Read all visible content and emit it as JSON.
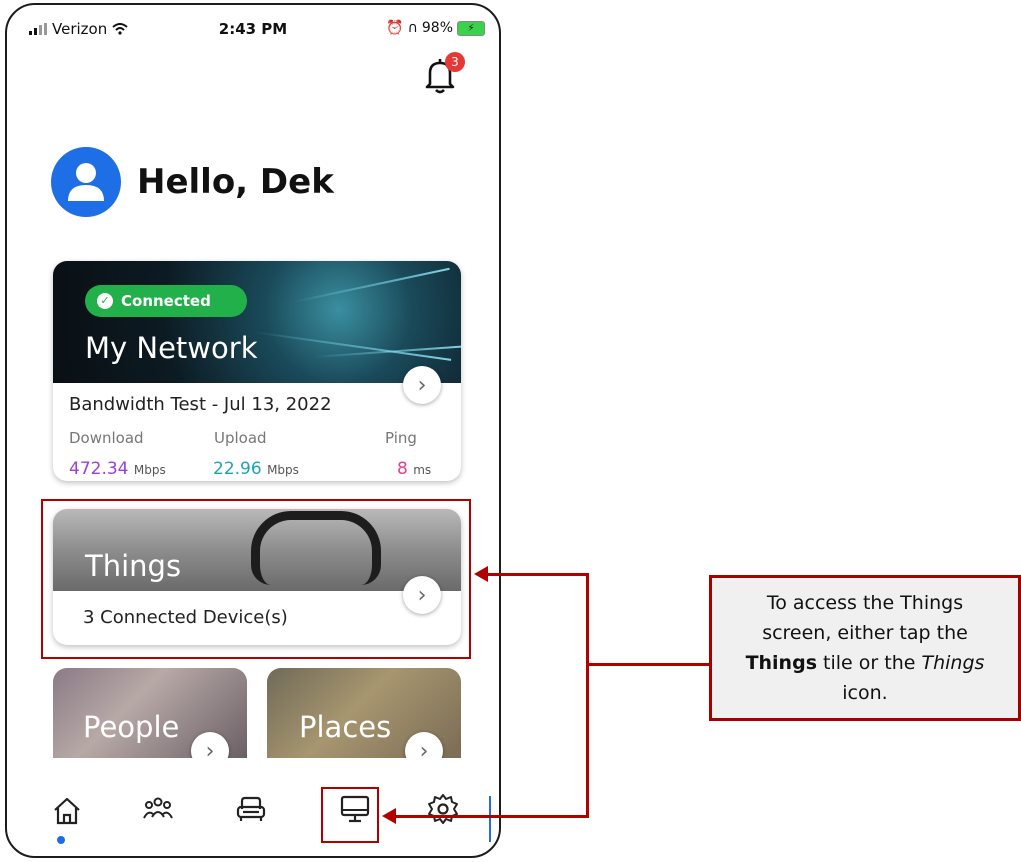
{
  "status_bar": {
    "carrier": "Verizon",
    "time": "2:43 PM",
    "battery": "98%"
  },
  "notifications": {
    "badge_count": "3"
  },
  "greeting": {
    "text": "Hello, Dek"
  },
  "network_card": {
    "status": "Connected",
    "title": "My Network",
    "bandwidth_title": "Bandwidth Test - Jul 13, 2022",
    "metrics": [
      {
        "label": "Download",
        "value": "472.34",
        "unit": "Mbps",
        "color": "#9b3fd8"
      },
      {
        "label": "Upload",
        "value": "22.96",
        "unit": "Mbps",
        "color": "#1fa3b8"
      },
      {
        "label": "Ping",
        "value": "8",
        "unit": "ms",
        "color": "#e83e8c"
      }
    ]
  },
  "things_card": {
    "title": "Things",
    "subtitle": "3 Connected Device(s)"
  },
  "people_card": {
    "title": "People"
  },
  "places_card": {
    "title": "Places"
  },
  "tab_bar": {
    "items": [
      {
        "name": "home-icon",
        "active": true
      },
      {
        "name": "people-icon",
        "active": false
      },
      {
        "name": "places-icon",
        "active": false
      },
      {
        "name": "things-icon",
        "active": false
      },
      {
        "name": "settings-icon",
        "active": false
      }
    ],
    "active_color": "#1e6fe6"
  },
  "callout": {
    "prefix": "To access the Things screen, either tap the ",
    "bold": "Things",
    "middle": " tile or the ",
    "italic": "Things",
    "suffix": " icon."
  },
  "colors": {
    "accent": "#1e6fe6",
    "connected": "#22b04a",
    "annotation": "#b00000"
  }
}
